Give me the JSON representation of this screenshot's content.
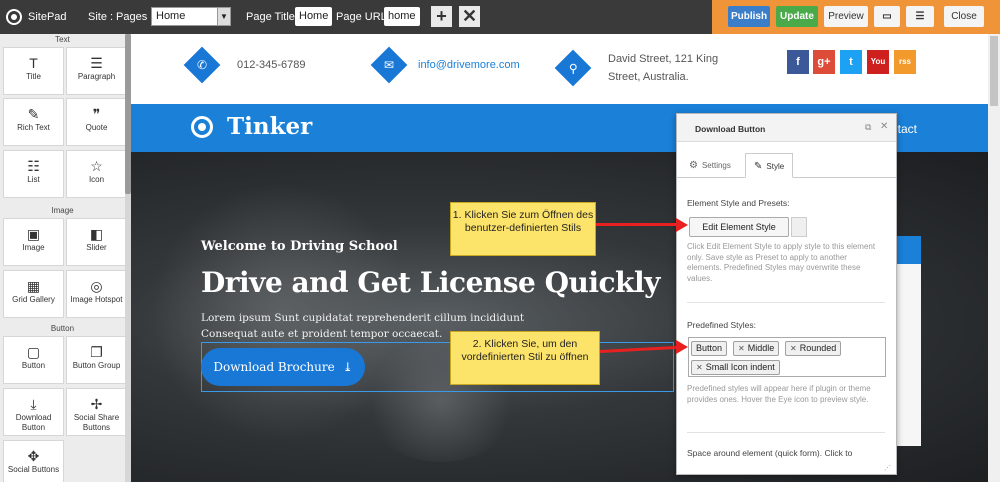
{
  "topbar": {
    "brand": "SitePad",
    "site_label": "Site :",
    "pages_label": "Pages :",
    "pages_selected": "Home",
    "page_title_label": "Page Title:",
    "page_title_value": "Home",
    "page_url_label": "Page URL:",
    "page_url_value": "home",
    "publish": "Publish",
    "update": "Update",
    "preview": "Preview",
    "close": "Close",
    "colors": {
      "bar": "#3a3a3a",
      "right": "#f0943a",
      "publish": "#3a7ec9",
      "update": "#4aaa4a"
    }
  },
  "left_panel": {
    "sections": {
      "text": "Text",
      "image": "Image",
      "button": "Button"
    },
    "widgets": [
      {
        "label": "Title",
        "icon": "title-icon",
        "glyph": "T"
      },
      {
        "label": "Paragraph",
        "icon": "paragraph-icon",
        "glyph": "☰"
      },
      {
        "label": "Rich Text",
        "icon": "rich-text-icon",
        "glyph": "✎"
      },
      {
        "label": "Quote",
        "icon": "quote-icon",
        "glyph": "❞"
      },
      {
        "label": "List",
        "icon": "list-icon",
        "glyph": "☷"
      },
      {
        "label": "Icon",
        "icon": "star-icon",
        "glyph": "☆"
      },
      {
        "label": "Image",
        "icon": "image-icon",
        "glyph": "▣"
      },
      {
        "label": "Slider",
        "icon": "slider-icon",
        "glyph": "◧"
      },
      {
        "label": "Grid Gallery",
        "icon": "grid-gallery-icon",
        "glyph": "▦"
      },
      {
        "label": "Image Hotspot",
        "icon": "image-hotspot-icon",
        "glyph": "◎"
      },
      {
        "label": "Button",
        "icon": "button-icon",
        "glyph": "▢"
      },
      {
        "label": "Button Group",
        "icon": "button-group-icon",
        "glyph": "❐"
      },
      {
        "label": "Download Button",
        "icon": "download-button-icon",
        "glyph": "⤓"
      },
      {
        "label": "Social Share Buttons",
        "icon": "social-share-icon",
        "glyph": "✢"
      },
      {
        "label": "Social Buttons",
        "icon": "social-buttons-icon",
        "glyph": "✥"
      }
    ]
  },
  "site": {
    "phone": "012-345-6789",
    "email": "info@drivemore.com",
    "address_line1": "David Street, 121 King",
    "address_line2": "Street, Australia.",
    "social": [
      {
        "label": "f",
        "icon": "facebook-icon",
        "color": "#3b5998"
      },
      {
        "label": "g+",
        "icon": "google-plus-icon",
        "color": "#dd4b39"
      },
      {
        "label": "t",
        "icon": "twitter-icon",
        "color": "#1da1f2"
      },
      {
        "label": "You",
        "icon": "youtube-icon",
        "color": "#cd201f"
      },
      {
        "label": "rss",
        "icon": "rss-icon",
        "color": "#f39a2c"
      }
    ],
    "brand": "Tinker",
    "nav_partial": "ntact",
    "hero_welcome": "Welcome to Driving School",
    "hero_title": "Drive and Get License Quickly",
    "hero_text_1": "Lorem ipsum Sunt cupidatat reprehenderit cillum incididunt",
    "hero_text_2": "Consequat aute et proident tempor occaecat.",
    "download_button": "Download Brochure",
    "accent": "#1a80d8"
  },
  "widget_panel": {
    "title": "Download Button",
    "tab_settings": "Settings",
    "tab_style": "Style",
    "element_style_heading": "Element Style and Presets:",
    "edit_element_style": "Edit Element Style",
    "help_1": "Click Edit Element Style to apply style to this element only. Save style as Preset to apply to another elements. Predefined Styles may overwrite these values.",
    "predefined_heading": "Predefined Styles:",
    "tags": [
      "Button",
      "Middle",
      "Rounded",
      "Small Icon indent"
    ],
    "help_2": "Predefined styles will appear here if plugin or theme provides ones. Hover the Eye icon to preview style.",
    "space_heading": "Space around element (quick form). Click to"
  },
  "callouts": {
    "one": "1. Klicken Sie zum Öffnen des benutzer-definierten Stils",
    "two": "2. Klicken Sie, um den vordefinierten Stil zu öffnen"
  }
}
